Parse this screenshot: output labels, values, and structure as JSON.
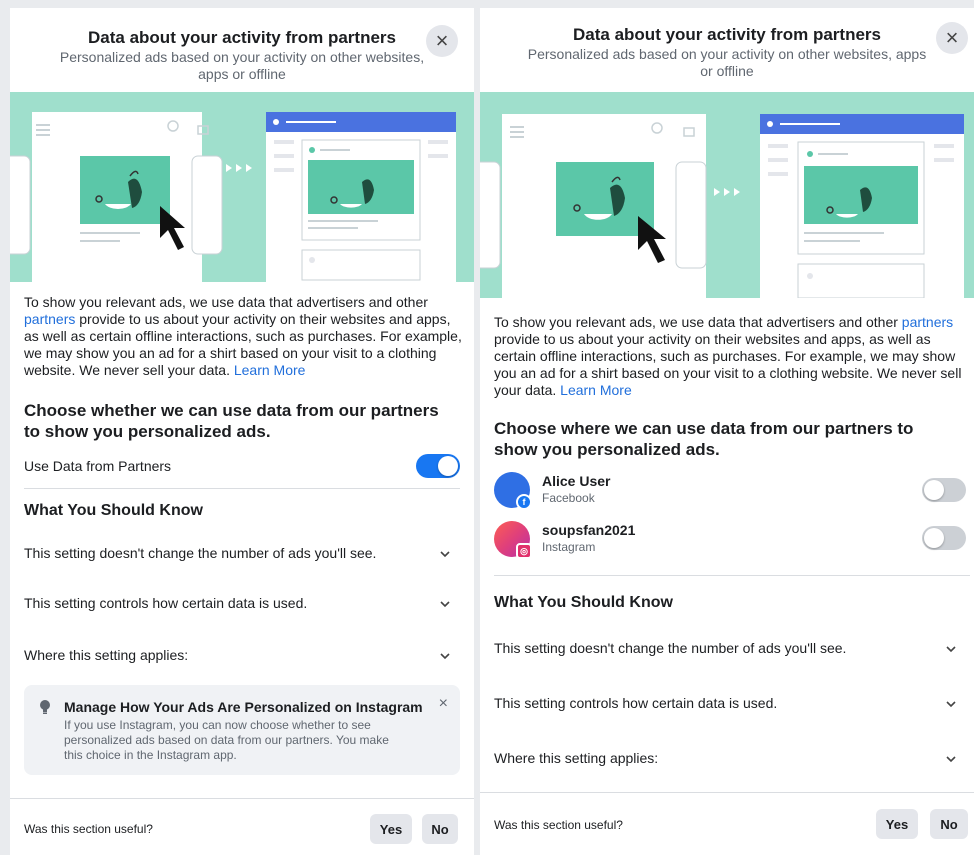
{
  "left": {
    "header": {
      "title": "Data about your activity from partners",
      "subtitle": "Personalized ads based on your activity on other websites, apps or offline"
    },
    "description": {
      "part1": "To show you relevant ads, we use data that advertisers and other ",
      "partners_link": "partners",
      "part2": " provide to us about your activity on their websites and apps, as well as certain offline interactions, such as purchases. For example, we may show you an ad for a shirt based on your visit to a clothing website. We never sell your data. ",
      "learn_more": "Learn More"
    },
    "choose_heading": "Choose whether we can use data from our partners to show you personalized ads.",
    "toggle_row": {
      "label": "Use Data from Partners",
      "enabled": true
    },
    "know_heading": "What You Should Know",
    "accordion": [
      "This setting doesn't change the number of ads you'll see.",
      "This setting controls how certain data is used.",
      "Where this setting applies:"
    ],
    "tip": {
      "title": "Manage How Your Ads Are Personalized on Instagram",
      "body": "If you use Instagram, you can now choose whether to see personalized ads based on data from our partners. You make this choice in the Instagram app."
    },
    "footer": {
      "question": "Was this section useful?",
      "yes": "Yes",
      "no": "No"
    }
  },
  "right": {
    "header": {
      "title": "Data about your activity from partners",
      "subtitle": "Personalized ads based on your activity on other websites, apps or offline"
    },
    "description": {
      "part1": "To show you relevant ads, we use data that advertisers and other ",
      "partners_link": "partners",
      "part2": " provide to us about your activity on their websites and apps, as well as certain offline interactions, such as purchases. For example, we may show you an ad for a shirt based on your visit to a clothing website. We never sell your data. ",
      "learn_more": "Learn More"
    },
    "choose_heading": "Choose where we can use data from our partners to show you personalized ads.",
    "accounts": [
      {
        "name": "Alice User",
        "platform": "Facebook",
        "enabled": false
      },
      {
        "name": "soupsfan2021",
        "platform": "Instagram",
        "enabled": false
      }
    ],
    "know_heading": "What You Should Know",
    "accordion": [
      "This setting doesn't change the number of ads you'll see.",
      "This setting controls how certain data is used.",
      "Where this setting applies:"
    ],
    "footer": {
      "question": "Was this section useful?",
      "yes": "Yes",
      "no": "No"
    }
  },
  "colors": {
    "accent": "#1877f2",
    "link": "#216fdb",
    "illustration_bg": "#9fdfcc",
    "illustration_card": "#5bc7a8"
  },
  "icons": {
    "close": "close-icon",
    "chevron": "chevron-down-icon",
    "bulb": "lightbulb-icon",
    "facebook_badge": "facebook-icon",
    "instagram_badge": "instagram-icon"
  }
}
